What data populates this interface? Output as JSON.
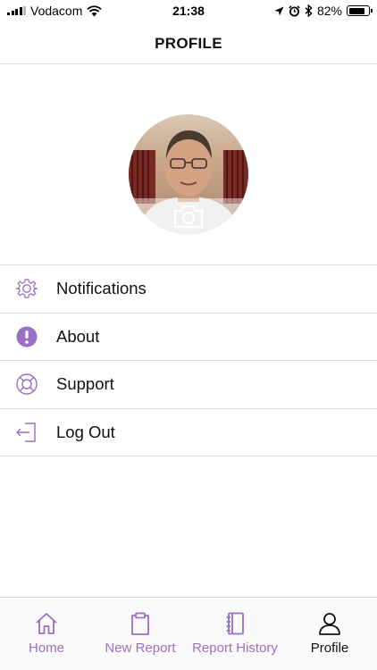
{
  "status_bar": {
    "carrier": "Vodacom",
    "time": "21:38",
    "battery": "82%",
    "battery_level": 0.82
  },
  "header": {
    "title": "PROFILE"
  },
  "avatar": {
    "icon": "camera-icon"
  },
  "menu": {
    "items": [
      {
        "label": "Notifications",
        "icon": "gear-icon"
      },
      {
        "label": "About",
        "icon": "info-exclamation-icon"
      },
      {
        "label": "Support",
        "icon": "lifebuoy-icon"
      },
      {
        "label": "Log Out",
        "icon": "logout-icon"
      }
    ]
  },
  "tabs": [
    {
      "label": "Home",
      "icon": "home-icon",
      "active": false
    },
    {
      "label": "New Report",
      "icon": "clipboard-icon",
      "active": false
    },
    {
      "label": "Report History",
      "icon": "notebook-icon",
      "active": false
    },
    {
      "label": "Profile",
      "icon": "user-icon",
      "active": true
    }
  ],
  "colors": {
    "accent": "#9b6fc3",
    "active_tab": "#111111",
    "divider": "#dcdcdc"
  }
}
